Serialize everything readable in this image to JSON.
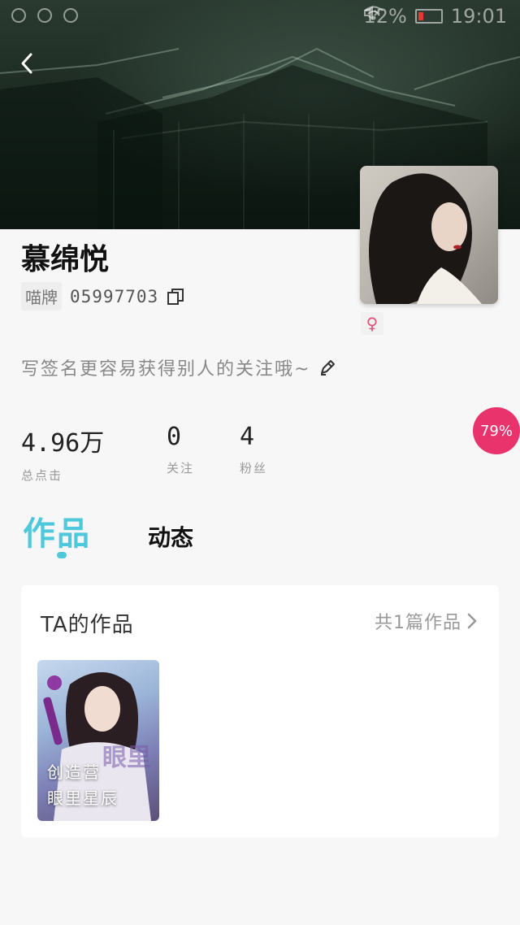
{
  "status_bar": {
    "battery_percent": "12%",
    "time": "19:01"
  },
  "profile": {
    "username": "慕绵悦",
    "id_label": "喵牌",
    "id_value": "05997703",
    "gender_symbol": "♀",
    "signature": "写签名更容易获得别人的关注哦~"
  },
  "stats": {
    "views_value": "4.96万",
    "views_label": "总点击",
    "following_value": "0",
    "following_label": "关注",
    "fans_value": "4",
    "fans_label": "粉丝"
  },
  "progress_badge": "79%",
  "tabs": {
    "works": "作品",
    "dynamic": "动态"
  },
  "works_card": {
    "title": "TA的作品",
    "count": "共1篇作品",
    "items": [
      {
        "caption_line1": "创造营",
        "caption_line2": "眼里星辰"
      }
    ]
  },
  "colors": {
    "accent": "#4fc8dc",
    "badge": "#e8336d",
    "female": "#e0507a"
  }
}
